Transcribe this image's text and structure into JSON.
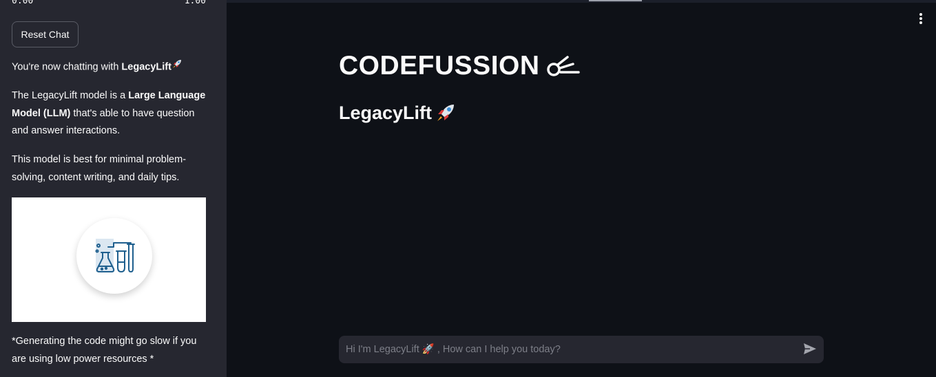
{
  "sidebar": {
    "slider": {
      "min_label": "0.00",
      "max_label": "1.00"
    },
    "reset_button_label": "Reset Chat",
    "chatting_prefix": "You're now chatting with ",
    "model_name": "LegacyLift",
    "desc_1": "The LegacyLift model is a ",
    "desc_bold": "Large Language Model (LLM)",
    "desc_2": " that's able to have question and answer interactions.",
    "best_for": "This model is best for minimal problem-solving, content writing, and daily tips.",
    "image_icon": "lab-flask-icon",
    "warning": "*Generating the code might go slow if you are using low power resources *"
  },
  "main": {
    "title": "CODEFUSSION",
    "title_icon": "comet-icon",
    "subtitle": "LegacyLift",
    "subtitle_icon": "rocket-icon",
    "menu_icon": "vertical-dots-icon"
  },
  "chat": {
    "placeholder": "Hi I'm LegacyLift 🚀 , How can I help you today?",
    "send_icon": "send-icon"
  },
  "colors": {
    "background": "#0e1117",
    "sidebar": "#262730",
    "text": "#fafafa",
    "input_bg": "#262730"
  }
}
